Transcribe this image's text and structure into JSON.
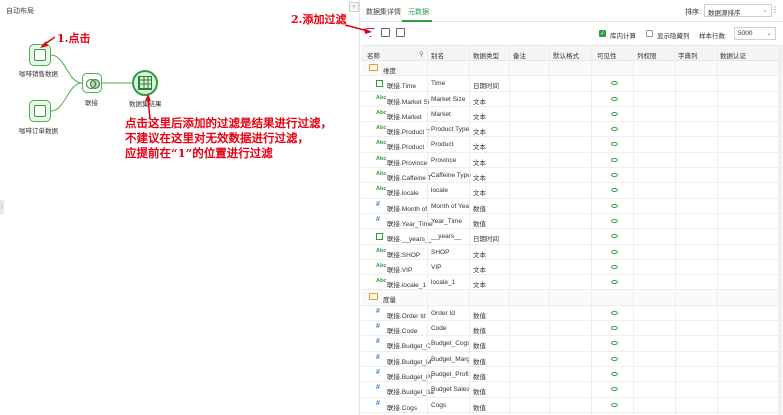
{
  "left": {
    "title": "自动布局",
    "collapse_icon": "double-chevron-left-icon",
    "nodes": [
      {
        "label": "咖啡销售数据",
        "icon": "table-icon"
      },
      {
        "label": "咖啡订单数据",
        "icon": "table-icon"
      },
      {
        "label": "联接",
        "icon": "join-icon"
      },
      {
        "label": "数据集结果",
        "icon": "grid-icon"
      }
    ]
  },
  "annotations": {
    "a1": "1.点击",
    "a2": "2.添加过滤",
    "a3_lines": [
      "点击这里后添加的过滤是结果进行过滤，",
      "不建议在这里对无效数据进行过滤，",
      "应提前在“1”的位置进行过滤"
    ]
  },
  "right": {
    "tabs": [
      {
        "label": "数据集详情"
      },
      {
        "label": "元数据"
      }
    ],
    "sort_label": "排序:",
    "sort_value": "数据源排序",
    "toolbar": {
      "db_compute_label": "库内计算",
      "show_hidden_label": "显示隐藏列",
      "sample_rows_label": "样本行数:",
      "sample_rows_value": "5000"
    },
    "columns": [
      "名称",
      "别名",
      "数据类型",
      "备注",
      "默认格式",
      "可见性",
      "列权限",
      "字典列",
      "数据认证"
    ],
    "groups": [
      {
        "name": "维度",
        "rows": [
          {
            "name": "联接.Time",
            "alias": "Time",
            "type": "日期时间",
            "kind": "date"
          },
          {
            "name": "联接.Market Si",
            "alias": "Market Size",
            "type": "文本",
            "kind": "abc"
          },
          {
            "name": "联接.Market",
            "alias": "Market",
            "type": "文本",
            "kind": "abc"
          },
          {
            "name": "联接.Product T",
            "alias": "Product Type",
            "type": "文本",
            "kind": "abc"
          },
          {
            "name": "联接.Product",
            "alias": "Product",
            "type": "文本",
            "kind": "abc"
          },
          {
            "name": "联接.Province",
            "alias": "Province",
            "type": "文本",
            "kind": "abc"
          },
          {
            "name": "联接.Caffeine T",
            "alias": "Caffeine Type",
            "type": "文本",
            "kind": "abc"
          },
          {
            "name": "联接.locale",
            "alias": "locale",
            "type": "文本",
            "kind": "abc"
          },
          {
            "name": "联接.Month of",
            "alias": "Month of Yea",
            "type": "数值",
            "kind": "hash"
          },
          {
            "name": "联接.Year_Time",
            "alias": "Year_Time",
            "type": "数值",
            "kind": "hash"
          },
          {
            "name": "联接.__years__",
            "alias": "__years__",
            "type": "日期时间",
            "kind": "date"
          },
          {
            "name": "联接.SHOP",
            "alias": "SHOP",
            "type": "文本",
            "kind": "abc"
          },
          {
            "name": "联接.VIP",
            "alias": "VIP",
            "type": "文本",
            "kind": "abc"
          },
          {
            "name": "联接.locale_1",
            "alias": "locale_1",
            "type": "文本",
            "kind": "abc"
          }
        ]
      },
      {
        "name": "度量",
        "rows": [
          {
            "name": "联接.Order Id",
            "alias": "Order Id",
            "type": "数值",
            "kind": "hash"
          },
          {
            "name": "联接.Code",
            "alias": "Code",
            "type": "数值",
            "kind": "hash"
          },
          {
            "name": "联接.Budget_C",
            "alias": "Budget_Cogs",
            "type": "数值",
            "kind": "hash"
          },
          {
            "name": "联接.Budget_M",
            "alias": "Budget_Marg",
            "type": "数值",
            "kind": "hash"
          },
          {
            "name": "联接.Budget_Pr",
            "alias": "Budget_Profit",
            "type": "数值",
            "kind": "hash"
          },
          {
            "name": "联接.Budget_Sa",
            "alias": "Budget Sales",
            "type": "数值",
            "kind": "hash"
          },
          {
            "name": "联接.Cogs",
            "alias": "Cogs",
            "type": "数值",
            "kind": "hash"
          }
        ]
      }
    ],
    "accent": "#2e9e44",
    "annotation_color": "#e60012"
  }
}
